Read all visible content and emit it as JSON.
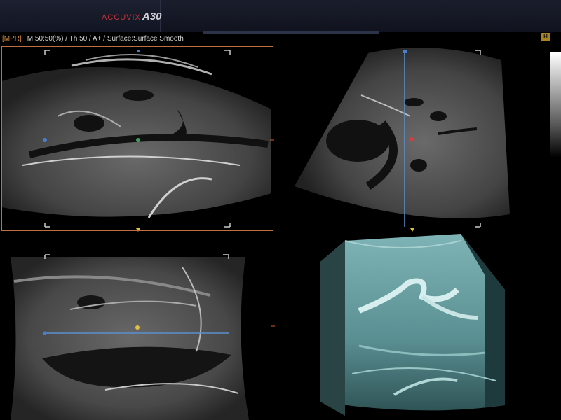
{
  "header": {
    "brand_prefix": "ACCUVIX",
    "brand_model": "A30"
  },
  "status_bar": {
    "mode": "[MPR]",
    "params": "M 50:50(%) / Th 50 / A+ / Surface:Surface Smooth"
  },
  "indicator": {
    "badge": "H"
  },
  "colors": {
    "frame_accent": "#c07040",
    "brand": "#c8323a",
    "marker_blue": "#4a7fd0",
    "marker_green": "#3aa060",
    "marker_red": "#d04040",
    "marker_yellow": "#e0c040",
    "render_tint": "#6fa6a8"
  },
  "icons": {
    "active": "orange-frame",
    "cursor": "dot-marker"
  }
}
